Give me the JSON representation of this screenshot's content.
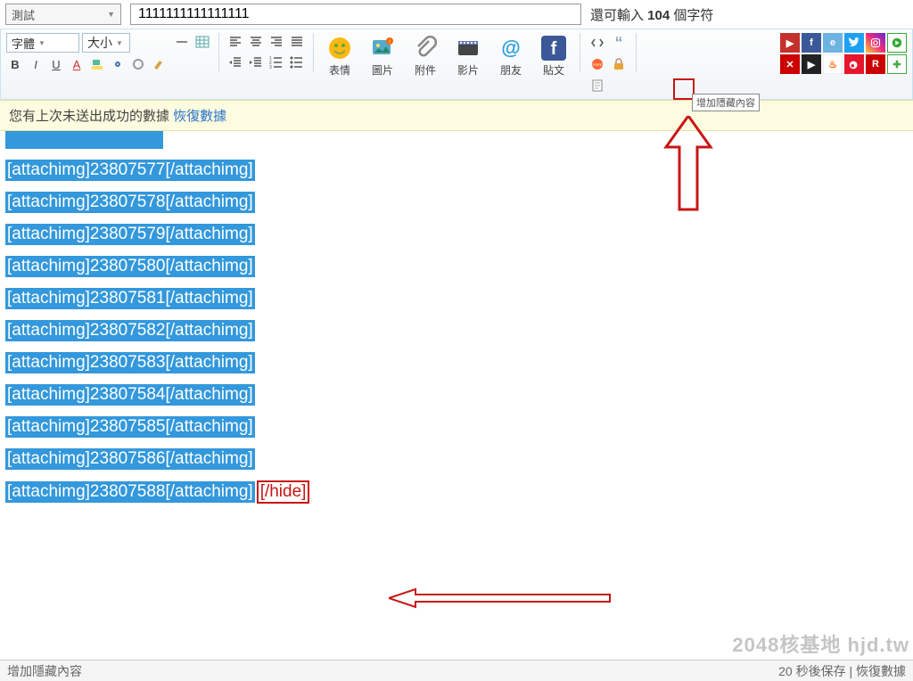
{
  "header": {
    "type_select": "測試",
    "title_value": "1111111111111111",
    "char_count_prefix": "還可輸入 ",
    "char_count_num": "104",
    "char_count_suffix": " 個字符"
  },
  "toolbar": {
    "font_label": "字體",
    "size_label": "大小",
    "big_buttons": {
      "emotion": "表情",
      "image": "圖片",
      "attach": "附件",
      "video": "影片",
      "friend": "朋友",
      "post": "貼文"
    }
  },
  "notice": {
    "text": "您有上次未送出成功的數據 ",
    "link": "恢復數據"
  },
  "editor": {
    "lines": [
      "[attachimg]23807577[/attachimg]",
      "[attachimg]23807578[/attachimg]",
      "[attachimg]23807579[/attachimg]",
      "[attachimg]23807580[/attachimg]",
      "[attachimg]23807581[/attachimg]",
      "[attachimg]23807582[/attachimg]",
      "[attachimg]23807583[/attachimg]",
      "[attachimg]23807584[/attachimg]",
      "[attachimg]23807585[/attachimg]",
      "[attachimg]23807586[/attachimg]"
    ],
    "last_line": "[attachimg]23807588[/attachimg]",
    "hide_tag": "[/hide]"
  },
  "tooltip": "增加隱藏內容",
  "status": {
    "left": "增加隱藏內容",
    "right": "20 秒後保存   | 恢復數據"
  },
  "watermark": "2048核基地 hjd.tw"
}
